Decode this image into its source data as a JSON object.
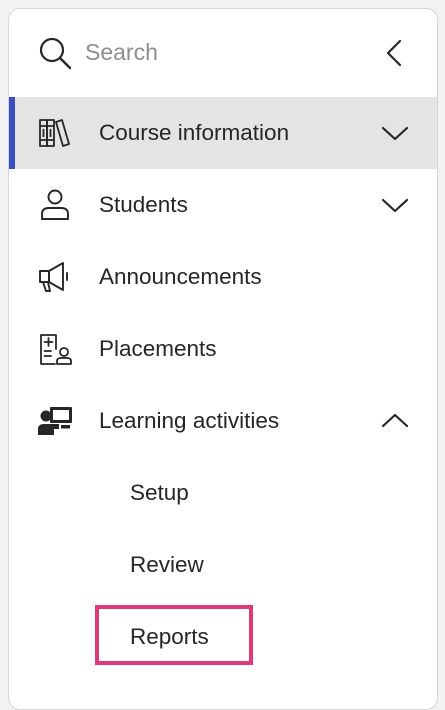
{
  "search": {
    "placeholder": "Search",
    "value": ""
  },
  "nav": {
    "items": [
      {
        "label": "Course information",
        "icon": "books-icon",
        "expanded": false,
        "active": true
      },
      {
        "label": "Students",
        "icon": "person-icon",
        "expanded": false,
        "active": false
      },
      {
        "label": "Announcements",
        "icon": "megaphone-icon",
        "active": false
      },
      {
        "label": "Placements",
        "icon": "placement-board-icon",
        "active": false
      },
      {
        "label": "Learning activities",
        "icon": "presenter-icon",
        "expanded": true,
        "active": false
      }
    ],
    "subitems": [
      {
        "label": "Setup"
      },
      {
        "label": "Review"
      },
      {
        "label": "Reports"
      }
    ]
  },
  "colors": {
    "active_indicator": "#3b4fc4",
    "active_background": "#e4e4e4",
    "highlight": "#e0397a",
    "text": "#262626",
    "placeholder": "#8e8e8e"
  }
}
